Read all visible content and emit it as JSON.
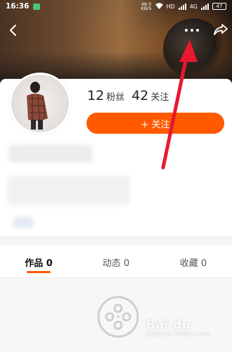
{
  "status_bar": {
    "time": "16:36",
    "net_speed_value": "48.0",
    "net_speed_unit": "KB/S",
    "hd_label": "HD",
    "network_label": "4G",
    "battery": "47"
  },
  "profile": {
    "stats": [
      {
        "value": "12",
        "label": "粉丝"
      },
      {
        "value": "42",
        "label": "关注"
      }
    ],
    "follow_button": "+ 关注"
  },
  "tabs": [
    {
      "label": "作品 0",
      "active": true
    },
    {
      "label": "动态 0",
      "active": false
    },
    {
      "label": "收藏 0",
      "active": false
    }
  ],
  "watermark": {
    "brand": "Bai du",
    "sub": "jingyan.baidu.com"
  },
  "colors": {
    "accent": "#ff5a00",
    "annotation": "#e8182f"
  },
  "icons": {
    "back": "chevron-left-icon",
    "more": "more-dots-icon",
    "share": "share-arrow-icon",
    "empty": "film-reel-icon"
  }
}
